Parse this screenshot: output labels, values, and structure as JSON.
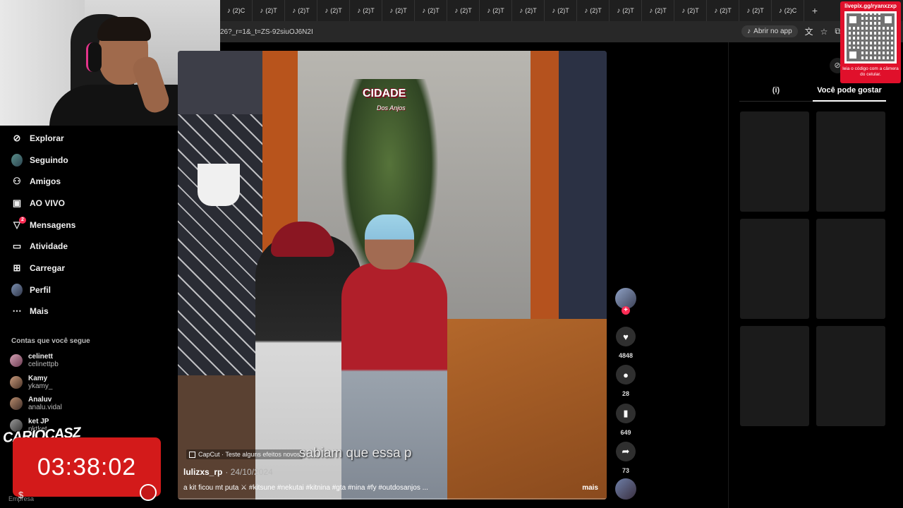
{
  "browser": {
    "tabs": [
      "(2)C",
      "(2)T",
      "(2)T",
      "(2)T",
      "(2)T",
      "(2)T",
      "(2)T",
      "(2)T",
      "(2)T",
      "(2)T",
      "(2)T",
      "(2)T",
      "(2)T",
      "(2)T",
      "(2)T",
      "(2)T",
      "(2)T",
      "(2)C"
    ],
    "new_tab_label": "+",
    "url": "26?_r=1&_t=ZS-92siuOJ6N2I",
    "open_app_label": "Abrir no app"
  },
  "sidebar": {
    "items": [
      {
        "label": "Explorar",
        "icon": "compass-icon"
      },
      {
        "label": "Seguindo",
        "icon": "following-avatar-icon"
      },
      {
        "label": "Amigos",
        "icon": "friends-icon"
      },
      {
        "label": "AO VIVO",
        "icon": "live-tv-icon"
      },
      {
        "label": "Mensagens",
        "icon": "messages-icon",
        "badge": "2"
      },
      {
        "label": "Atividade",
        "icon": "activity-icon"
      },
      {
        "label": "Carregar",
        "icon": "upload-icon"
      },
      {
        "label": "Perfil",
        "icon": "profile-avatar-icon"
      },
      {
        "label": "Mais",
        "icon": "more-icon"
      }
    ],
    "following_title": "Contas que você segue",
    "following": [
      {
        "name": "celinett",
        "handle": "celinettpb"
      },
      {
        "name": "Kamy",
        "handle": "ykamy_"
      },
      {
        "name": "Analuv",
        "handle": "analu.vidal"
      },
      {
        "name": "ket JP",
        "handle": "nktket"
      }
    ],
    "footer": "Empresa"
  },
  "overlay": {
    "brand": "CARIOCASZ",
    "timer": "03:38:02",
    "qr_top": "livepix.gg/ryanxzxp",
    "qr_bottom": "leia o código com a câmera do celular."
  },
  "video": {
    "logo_title": "CIDADE",
    "logo_subtitle": "Dos Anjos",
    "subtitle": "sabiam que essa p",
    "capcut_label": "CapCut · Teste alguns efeitos novos",
    "author": "lulizxs_rp",
    "date": "· 24/10/2024",
    "caption": "a kit ficou mt puta ⚔ #kitsune #nekutai #kitnina #gta #nina #fy #outdosanjos ...",
    "more_label": "mais"
  },
  "actions": {
    "likes": "4848",
    "comments": "28",
    "saves": "649",
    "shares": "73"
  },
  "right_panel": {
    "tab_left": "(i)",
    "tab_right": "Você pode gostar"
  },
  "colors": {
    "accent": "#fe2c55",
    "timer_bg": "#d31a1a",
    "qr_bg": "#e0102b"
  }
}
